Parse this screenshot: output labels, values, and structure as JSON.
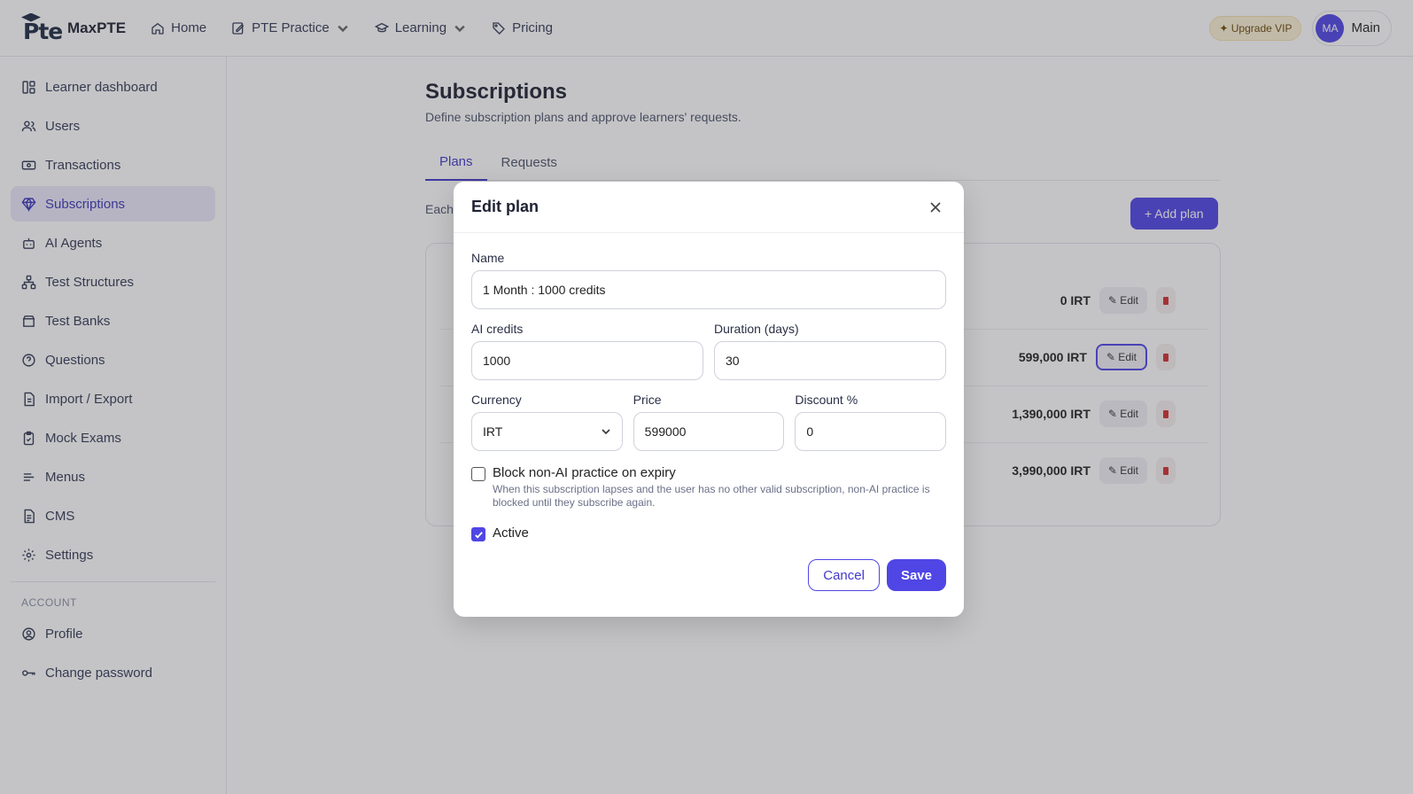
{
  "header": {
    "brand": "MaxPTE",
    "logo_text": "Pte",
    "nav": [
      {
        "label": "Home",
        "icon": "home-icon"
      },
      {
        "label": "PTE Practice",
        "icon": "edit-icon",
        "dropdown": true
      },
      {
        "label": "Learning",
        "icon": "graduation-cap-icon",
        "dropdown": true
      },
      {
        "label": "Pricing",
        "icon": "tag-icon"
      }
    ],
    "vip_label": "✦ Upgrade VIP",
    "avatar_initials": "MA",
    "user_name": "Main"
  },
  "sidebar": {
    "items": [
      {
        "label": "Learner dashboard",
        "icon": "dashboard-icon"
      },
      {
        "label": "Users",
        "icon": "users-icon"
      },
      {
        "label": "Transactions",
        "icon": "banknote-icon"
      },
      {
        "label": "Subscriptions",
        "icon": "gem-icon",
        "active": true
      },
      {
        "label": "AI Agents",
        "icon": "bot-icon"
      },
      {
        "label": "Test Structures",
        "icon": "network-icon"
      },
      {
        "label": "Test Banks",
        "icon": "archive-icon"
      },
      {
        "label": "Questions",
        "icon": "help-circle-icon"
      },
      {
        "label": "Import / Export",
        "icon": "file-transfer-icon"
      },
      {
        "label": "Mock Exams",
        "icon": "clipboard-icon"
      },
      {
        "label": "Menus",
        "icon": "menu-icon"
      },
      {
        "label": "CMS",
        "icon": "file-text-icon"
      },
      {
        "label": "Settings",
        "icon": "gear-icon"
      }
    ],
    "account_section": "ACCOUNT",
    "account_items": [
      {
        "label": "Profile",
        "icon": "user-circle-icon"
      },
      {
        "label": "Change password",
        "icon": "key-icon"
      }
    ]
  },
  "main": {
    "title": "Subscriptions",
    "subtitle": "Define subscription plans and approve learners' requests.",
    "tabs": [
      {
        "label": "Plans",
        "active": true
      },
      {
        "label": "Requests",
        "active": false
      }
    ],
    "each_text": "Each",
    "add_plan_label": "+ Add plan",
    "plans": [
      {
        "price": "0 IRT",
        "edit_label": "✎ Edit"
      },
      {
        "price": "599,000 IRT",
        "edit_label": "✎ Edit",
        "focused": true
      },
      {
        "price": "1,390,000 IRT",
        "edit_label": "✎ Edit"
      },
      {
        "price": "3,990,000 IRT",
        "edit_label": "✎ Edit"
      }
    ]
  },
  "modal": {
    "title": "Edit plan",
    "name_label": "Name",
    "name_value": "1 Month : 1000 credits",
    "ai_credits_label": "AI credits",
    "ai_credits_value": "1000",
    "duration_label": "Duration (days)",
    "duration_value": "30",
    "currency_label": "Currency",
    "currency_value": "IRT",
    "price_label": "Price",
    "price_value": "599000",
    "discount_label": "Discount %",
    "discount_value": "0",
    "block_label": "Block non-AI practice on expiry",
    "block_help": "When this subscription lapses and the user has no other valid subscription, non-AI practice is blocked until they subscribe again.",
    "block_checked": false,
    "active_label": "Active",
    "active_checked": true,
    "cancel_label": "Cancel",
    "save_label": "Save"
  },
  "colors": {
    "accent": "#4f46e5",
    "active_bg": "#ebe9fb",
    "danger": "#d32f2f",
    "overlay": "rgba(60,60,66,0.30)"
  }
}
